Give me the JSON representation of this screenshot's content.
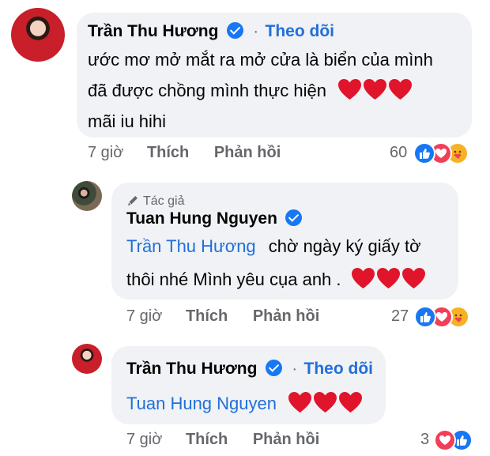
{
  "comment1": {
    "author": "Trần Thu Hương",
    "follow": "Theo dõi",
    "separator": "·",
    "lines": [
      "ước mơ mở mắt ra mở cửa là biển của mình",
      "đã được chồng mình thực hiện",
      "mãi iu hihi"
    ],
    "time": "7 giờ",
    "like": "Thích",
    "reply": "Phản hồi",
    "reaction_count": "60",
    "reactions": [
      "like-icon",
      "love-icon",
      "care-icon"
    ]
  },
  "comment2": {
    "author_tag": "Tác giả",
    "author": "Tuan Hung Nguyen",
    "mention": "Trần Thu Hương",
    "line1": "chờ ngày ký giấy tờ",
    "line2": "thôi nhé Mình yêu cụa anh .",
    "time": "7 giờ",
    "like": "Thích",
    "reply": "Phản hồi",
    "reaction_count": "27",
    "reactions": [
      "like-icon",
      "love-icon",
      "care-icon"
    ]
  },
  "comment3": {
    "author": "Trần Thu Hương",
    "follow": "Theo dõi",
    "separator": "·",
    "mention": "Tuan Hung Nguyen",
    "time": "7 giờ",
    "like": "Thích",
    "reply": "Phản hồi",
    "reaction_count": "3",
    "reactions": [
      "love-icon",
      "like-icon"
    ]
  },
  "colors": {
    "mention": "#216fdb",
    "bubble": "#f0f2f5",
    "meta": "#65676b",
    "heart": "#e0152b",
    "like": "#1877f2",
    "love": "#f33e58",
    "care": "#f7b125"
  }
}
